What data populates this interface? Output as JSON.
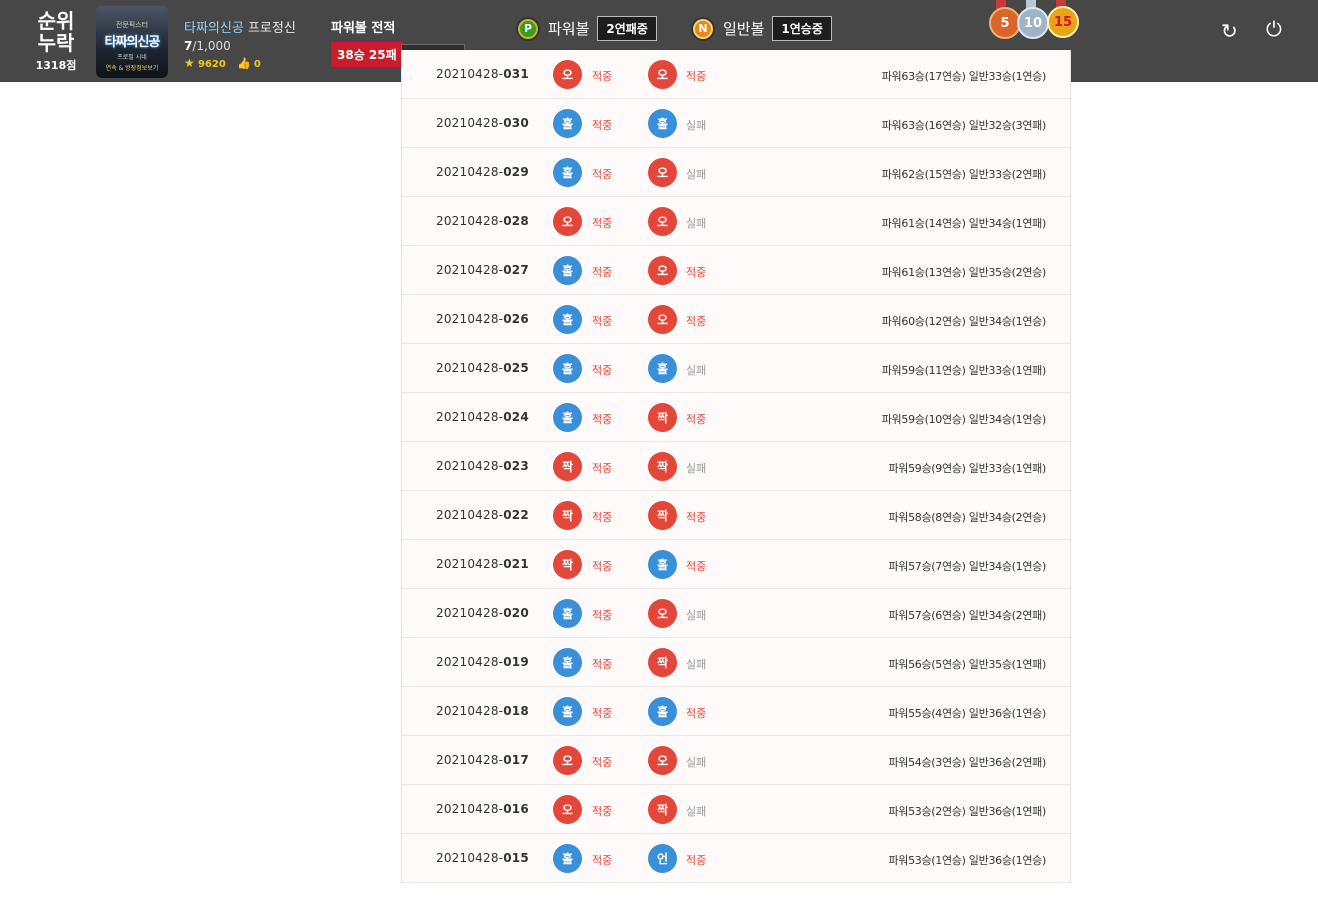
{
  "header": {
    "rank_title_1": "순위",
    "rank_title_2": "누락",
    "rank_score": "1318점",
    "avatar_line1": "전문픽스터",
    "avatar_line2": "타짜의신공",
    "avatar_line3": "프로필 시네",
    "avatar_line4": "연속 & 방장정보보기",
    "nickname": "타짜의신공",
    "role": "프로정신",
    "level_current": "7",
    "level_max": "/1,000",
    "points": "9620",
    "likes": "0",
    "record_title": "파워볼 전적",
    "record_value": "38승 25패",
    "power_coin": "P",
    "power_label": "파워볼",
    "power_streak": "2연패중",
    "normal_coin": "N",
    "normal_label": "일반볼",
    "normal_streak": "1연승중",
    "medal_5": "5",
    "medal_10": "10",
    "medal_15": "15",
    "refresh_icon": "↻",
    "power_icon": "⏻"
  },
  "history": [
    {
      "prefix": "20210428-",
      "num": "031",
      "b1": "오",
      "c1": "red",
      "r1": "적중",
      "h1": true,
      "b2": "오",
      "c2": "red",
      "r2": "적중",
      "h2": true,
      "summary": "파워63승(17연승) 일반33승(1연승)"
    },
    {
      "prefix": "20210428-",
      "num": "030",
      "b1": "홀",
      "c1": "blue",
      "r1": "적중",
      "h1": true,
      "b2": "홀",
      "c2": "blue",
      "r2": "실패",
      "h2": false,
      "summary": "파워63승(16연승) 일반32승(3연패)"
    },
    {
      "prefix": "20210428-",
      "num": "029",
      "b1": "홀",
      "c1": "blue",
      "r1": "적중",
      "h1": true,
      "b2": "오",
      "c2": "red",
      "r2": "실패",
      "h2": false,
      "summary": "파워62승(15연승) 일반33승(2연패)"
    },
    {
      "prefix": "20210428-",
      "num": "028",
      "b1": "오",
      "c1": "red",
      "r1": "적중",
      "h1": true,
      "b2": "오",
      "c2": "red",
      "r2": "실패",
      "h2": false,
      "summary": "파워61승(14연승) 일반34승(1연패)"
    },
    {
      "prefix": "20210428-",
      "num": "027",
      "b1": "홀",
      "c1": "blue",
      "r1": "적중",
      "h1": true,
      "b2": "오",
      "c2": "red",
      "r2": "적중",
      "h2": true,
      "summary": "파워61승(13연승) 일반35승(2연승)"
    },
    {
      "prefix": "20210428-",
      "num": "026",
      "b1": "홀",
      "c1": "blue",
      "r1": "적중",
      "h1": true,
      "b2": "오",
      "c2": "red",
      "r2": "적중",
      "h2": true,
      "summary": "파워60승(12연승) 일반34승(1연승)"
    },
    {
      "prefix": "20210428-",
      "num": "025",
      "b1": "홀",
      "c1": "blue",
      "r1": "적중",
      "h1": true,
      "b2": "홀",
      "c2": "blue",
      "r2": "실패",
      "h2": false,
      "summary": "파워59승(11연승) 일반33승(1연패)"
    },
    {
      "prefix": "20210428-",
      "num": "024",
      "b1": "홀",
      "c1": "blue",
      "r1": "적중",
      "h1": true,
      "b2": "짝",
      "c2": "red",
      "r2": "적중",
      "h2": true,
      "summary": "파워59승(10연승) 일반34승(1연승)"
    },
    {
      "prefix": "20210428-",
      "num": "023",
      "b1": "짝",
      "c1": "red",
      "r1": "적중",
      "h1": true,
      "b2": "짝",
      "c2": "red",
      "r2": "실패",
      "h2": false,
      "summary": "파워59승(9연승) 일반33승(1연패)"
    },
    {
      "prefix": "20210428-",
      "num": "022",
      "b1": "짝",
      "c1": "red",
      "r1": "적중",
      "h1": true,
      "b2": "짝",
      "c2": "red",
      "r2": "적중",
      "h2": true,
      "summary": "파워58승(8연승) 일반34승(2연승)"
    },
    {
      "prefix": "20210428-",
      "num": "021",
      "b1": "짝",
      "c1": "red",
      "r1": "적중",
      "h1": true,
      "b2": "홀",
      "c2": "blue",
      "r2": "적중",
      "h2": true,
      "summary": "파워57승(7연승) 일반34승(1연승)"
    },
    {
      "prefix": "20210428-",
      "num": "020",
      "b1": "홀",
      "c1": "blue",
      "r1": "적중",
      "h1": true,
      "b2": "오",
      "c2": "red",
      "r2": "실패",
      "h2": false,
      "summary": "파워57승(6연승) 일반34승(2연패)"
    },
    {
      "prefix": "20210428-",
      "num": "019",
      "b1": "홀",
      "c1": "blue",
      "r1": "적중",
      "h1": true,
      "b2": "짝",
      "c2": "red",
      "r2": "실패",
      "h2": false,
      "summary": "파워56승(5연승) 일반35승(1연패)"
    },
    {
      "prefix": "20210428-",
      "num": "018",
      "b1": "홀",
      "c1": "blue",
      "r1": "적중",
      "h1": true,
      "b2": "홀",
      "c2": "blue",
      "r2": "적중",
      "h2": true,
      "summary": "파워55승(4연승) 일반36승(1연승)"
    },
    {
      "prefix": "20210428-",
      "num": "017",
      "b1": "오",
      "c1": "red",
      "r1": "적중",
      "h1": true,
      "b2": "오",
      "c2": "red",
      "r2": "실패",
      "h2": false,
      "summary": "파워54승(3연승) 일반36승(2연패)"
    },
    {
      "prefix": "20210428-",
      "num": "016",
      "b1": "오",
      "c1": "red",
      "r1": "적중",
      "h1": true,
      "b2": "짝",
      "c2": "red",
      "r2": "실패",
      "h2": false,
      "summary": "파워53승(2연승) 일반36승(1연패)"
    },
    {
      "prefix": "20210428-",
      "num": "015",
      "b1": "홀",
      "c1": "blue",
      "r1": "적중",
      "h1": true,
      "b2": "언",
      "c2": "blue",
      "r2": "적중",
      "h2": true,
      "summary": "파워53승(1연승) 일반36승(1연승)"
    }
  ],
  "colors": {
    "topbar": "#474747",
    "red_ball": "#e2473a",
    "blue_ball": "#3a8fd9",
    "record_badge": "#c81e2c"
  }
}
